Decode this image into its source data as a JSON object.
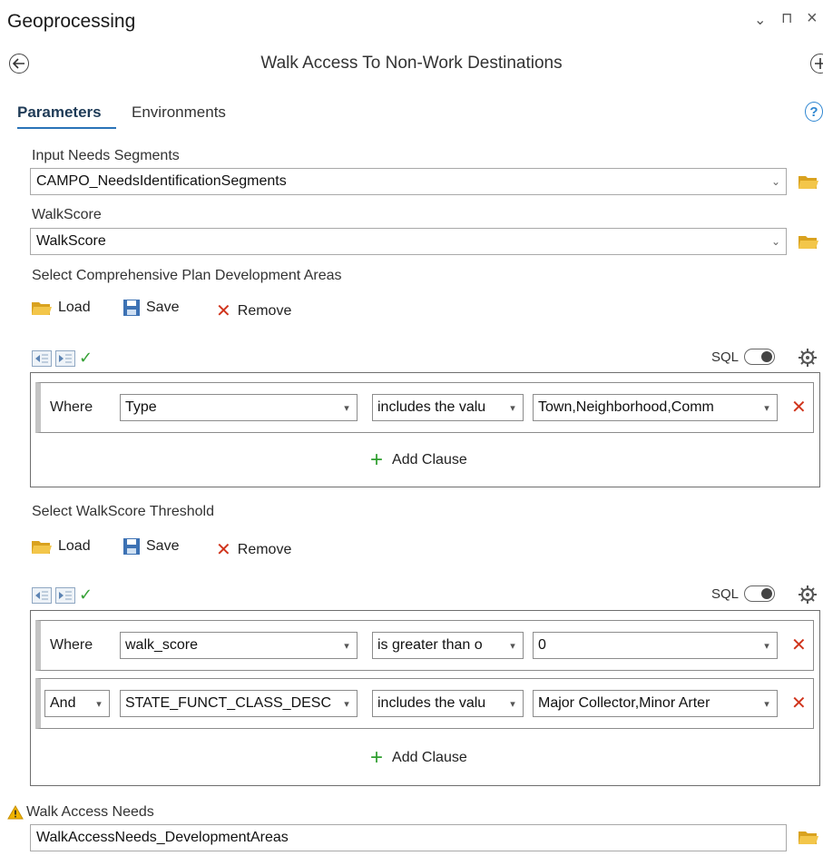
{
  "pane": {
    "title": "Geoprocessing",
    "controls": {
      "dropdown": "⌄",
      "pin": "⊓",
      "close": "×"
    }
  },
  "tool": {
    "title": "Walk Access To Non-Work Destinations",
    "back_icon": "back-arrow-icon",
    "add_icon": "plus-icon"
  },
  "tabs": [
    {
      "label": "Parameters",
      "active": true
    },
    {
      "label": "Environments",
      "active": false
    }
  ],
  "help": "?",
  "params": {
    "input_segments": {
      "label": "Input Needs Segments",
      "value": "CAMPO_NeedsIdentificationSegments"
    },
    "walkscore": {
      "label": "WalkScore",
      "value": "WalkScore"
    },
    "dev_areas": {
      "label": "Select Comprehensive Plan Development Areas",
      "toolbar": {
        "load": "Load",
        "save": "Save",
        "remove": "Remove"
      },
      "sql": "SQL",
      "clauses": [
        {
          "connector": "Where",
          "field": "Type",
          "operator": "includes the valu",
          "value": "Town,Neighborhood,Comm"
        }
      ],
      "add_clause": "Add Clause"
    },
    "threshold": {
      "label": "Select WalkScore Threshold",
      "toolbar": {
        "load": "Load",
        "save": "Save",
        "remove": "Remove"
      },
      "sql": "SQL",
      "clauses": [
        {
          "connector": "Where",
          "field": "walk_score",
          "operator": "is greater than o",
          "value": "0"
        },
        {
          "connector": "And",
          "field": "STATE_FUNCT_CLASS_DESC",
          "operator": "includes the valu",
          "value": "Major Collector,Minor Arter"
        }
      ],
      "add_clause": "Add Clause"
    },
    "output": {
      "label": "Walk Access Needs",
      "value": "WalkAccessNeeds_DevelopmentAreas",
      "warning_icon": "warning-icon"
    }
  },
  "colors": {
    "accent": "#2a73b8",
    "remove": "#d0341c",
    "add": "#2e9e2e",
    "folder": "#e8b730",
    "warning": "#f0b400"
  }
}
